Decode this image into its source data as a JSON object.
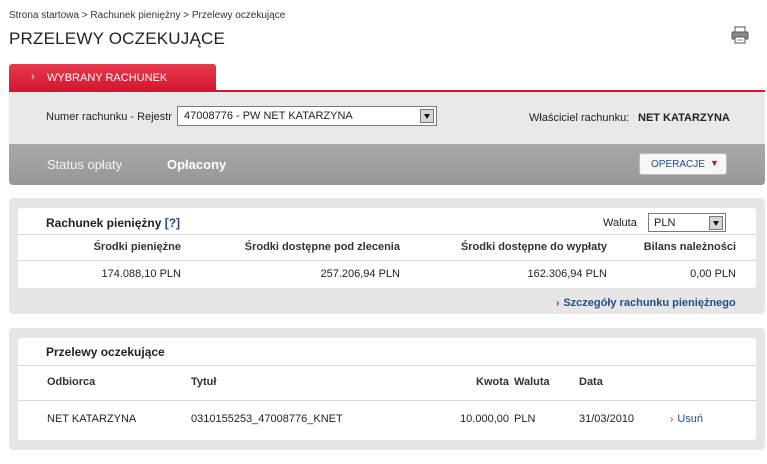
{
  "breadcrumb": "Strona startowa > Rachunek pieniężny > Przelewy oczekujące",
  "page_title": "PRZELEWY OCZEKUJĄCE",
  "tab": {
    "chevron": "›",
    "label": "WYBRANY RACHUNEK"
  },
  "account": {
    "label": "Numer rachunku - Rejestr",
    "selected": "47008776 - PW NET KATARZYNA",
    "owner_label": "Właściciel rachunku:",
    "owner_value": "NET KATARZYNA"
  },
  "status": {
    "label": "Status opłaty",
    "value": "Opłacony",
    "operations_label": "OPERACJE",
    "operations_chevron": "⌄"
  },
  "cash_account": {
    "title": "Rachunek pieniężny",
    "help": "[?]",
    "currency_label": "Waluta",
    "currency_selected": "PLN",
    "headers": [
      "Środki pieniężne",
      "Środki dostępne pod zlecenia",
      "Środki dostępne do wypłaty",
      "Bilans należności"
    ],
    "values": [
      "174.088,10  PLN",
      "257.206,94  PLN",
      "162.306,94  PLN",
      "0,00  PLN"
    ],
    "details_link": "Szczegóły rachunku pieniężnego"
  },
  "pending": {
    "title": "Przelewy oczekujące",
    "headers": {
      "recipient": "Odbiorca",
      "title": "Tytuł",
      "amount": "Kwota",
      "currency": "Waluta",
      "date": "Data"
    },
    "rows": [
      {
        "recipient": "NET KATARZYNA",
        "title": "0310155253_47008776_KNET",
        "amount": "10.000,00",
        "currency": "PLN",
        "date": "31/03/2010",
        "action": "Usuń"
      }
    ]
  },
  "colors": {
    "accent_red": "#d4162e",
    "link_blue": "#1e4d8a",
    "status_gray": "#a0a0a0"
  },
  "icons": [
    "printer-icon",
    "chevron-right-icon",
    "chevron-down-icon",
    "dropdown-arrow-icon"
  ]
}
